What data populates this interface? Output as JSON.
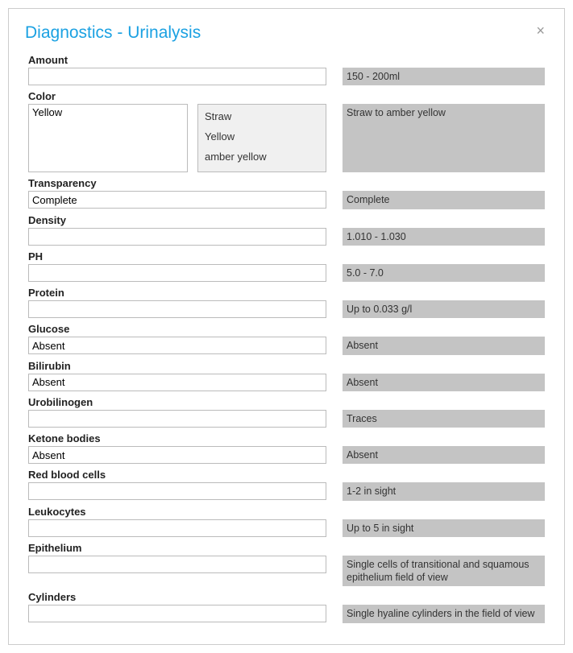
{
  "dialog": {
    "title": "Diagnostics - Urinalysis",
    "close": "×"
  },
  "fields": {
    "amount": {
      "label": "Amount",
      "value": "",
      "ref": "150 - 200ml"
    },
    "color": {
      "label": "Color",
      "value": "Yellow",
      "ref": "Straw to amber yellow",
      "options": [
        "Straw",
        "Yellow",
        "amber yellow"
      ]
    },
    "transparency": {
      "label": "Transparency",
      "value": "Complete",
      "ref": "Complete"
    },
    "density": {
      "label": "Density",
      "value": "",
      "ref": "1.010 - 1.030"
    },
    "ph": {
      "label": "PH",
      "value": "",
      "ref": "5.0 - 7.0"
    },
    "protein": {
      "label": "Protein",
      "value": "",
      "ref": "Up to 0.033 g/l"
    },
    "glucose": {
      "label": "Glucose",
      "value": "Absent",
      "ref": "Absent"
    },
    "bilirubin": {
      "label": "Bilirubin",
      "value": "Absent",
      "ref": "Absent"
    },
    "urobilinogen": {
      "label": "Urobilinogen",
      "value": "",
      "ref": "Traces"
    },
    "ketone": {
      "label": "Ketone bodies",
      "value": "Absent",
      "ref": "Absent"
    },
    "rbc": {
      "label": "Red blood cells",
      "value": "",
      "ref": "1-2 in sight"
    },
    "leukocytes": {
      "label": "Leukocytes",
      "value": "",
      "ref": "Up to 5 in sight"
    },
    "epithelium": {
      "label": "Epithelium",
      "value": "",
      "ref": "Single cells of transitional and squamous epithelium field of view"
    },
    "cylinders": {
      "label": "Cylinders",
      "value": "",
      "ref": "Single hyaline cylinders in the field of view"
    }
  }
}
